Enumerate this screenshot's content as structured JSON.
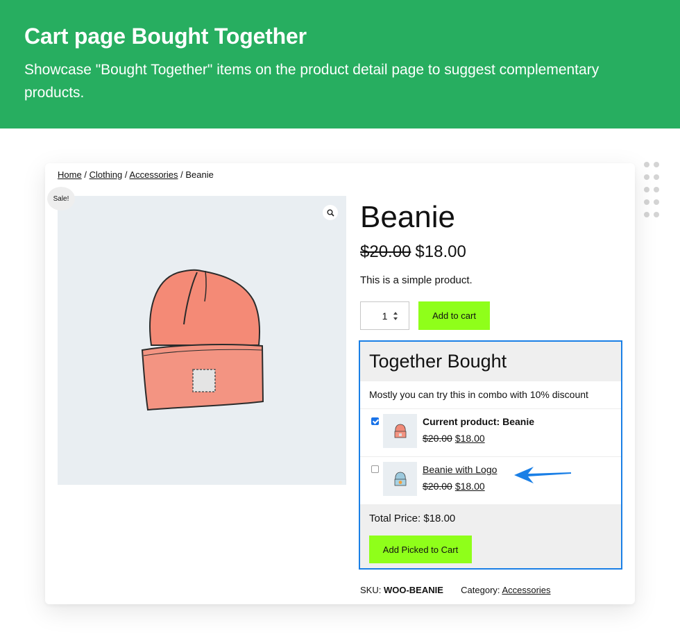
{
  "banner": {
    "title": "Cart page Bought Together",
    "subtitle": "Showcase \"Bought Together\" items on the product detail page to suggest complementary products."
  },
  "breadcrumb": {
    "home": "Home",
    "clothing": "Clothing",
    "accessories": "Accessories",
    "current": "Beanie",
    "separator": "/"
  },
  "product": {
    "sale_badge": "Sale!",
    "title": "Beanie",
    "old_price": "$20.00",
    "new_price": "$18.00",
    "description": "This is a simple product.",
    "quantity": "1",
    "add_to_cart": "Add to cart",
    "image_icon": "beanie-image",
    "zoom_icon": "magnifier-icon"
  },
  "together": {
    "heading": "Together Bought",
    "subheading": "Mostly you can try this in combo with 10% discount",
    "items": [
      {
        "name": "Current product: Beanie",
        "old_price": "$20.00",
        "new_price": "$18.00",
        "checked": true,
        "color": "#f08a78"
      },
      {
        "name": "Beanie with Logo ",
        "old_price": "$20.00",
        "new_price": "$18.00",
        "checked": false,
        "color": "#9cc9dd"
      }
    ],
    "total_label": "Total Price:",
    "total_value": "$18.00",
    "add_button": "Add Picked to Cart",
    "border_color": "#1a7fe6"
  },
  "meta": {
    "sku_label": "SKU:",
    "sku_value": "WOO-BEANIE",
    "category_label": "Category:",
    "category_value": "Accessories"
  },
  "colors": {
    "banner_bg": "#27ae60",
    "button_bg": "#8fff1a",
    "arrow": "#1a7fe6"
  }
}
